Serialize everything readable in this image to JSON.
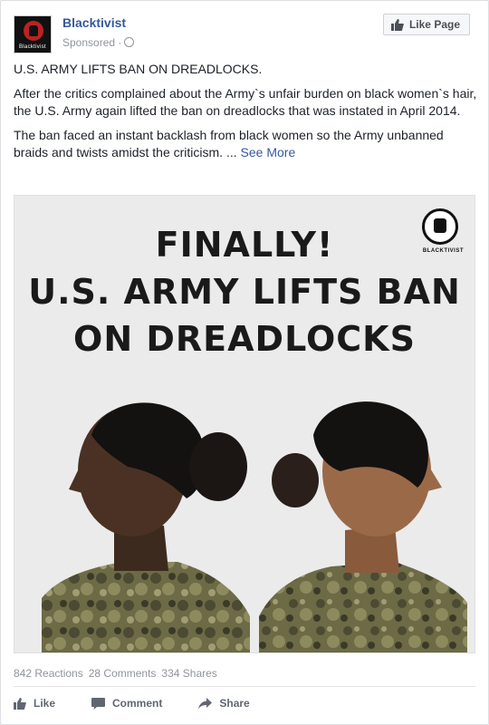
{
  "post": {
    "page_name": "Blacktivist",
    "avatar_text": "Blacktivist",
    "sponsored": "Sponsored ·",
    "like_page_label": "Like Page",
    "title": "U.S. ARMY LIFTS BAN ON DREADLOCKS.",
    "paragraph1": "After the critics complained about the Army`s unfair burden on black women`s hair, the U.S. Army again lifted the ban on dreadlocks that was instated in April 2014.",
    "paragraph2": "The ban faced an instant backlash from black women so the Army unbanned braids and twists amidst the criticism. ...",
    "see_more": "See More"
  },
  "image": {
    "headline_line1": "FINALLY!",
    "headline_line2": "U.S. ARMY LIFTS BAN",
    "headline_line3": "ON DREADLOCKS",
    "logo_text": "BLACKTIVIST"
  },
  "stats": {
    "reactions": "842 Reactions",
    "comments": "28 Comments",
    "shares": "334 Shares"
  },
  "actions": {
    "like": "Like",
    "comment": "Comment",
    "share": "Share"
  },
  "colors": {
    "link": "#365899",
    "muted": "#90949c",
    "camo_dark": "#4b4a32",
    "camo_light": "#8d8a5e"
  }
}
